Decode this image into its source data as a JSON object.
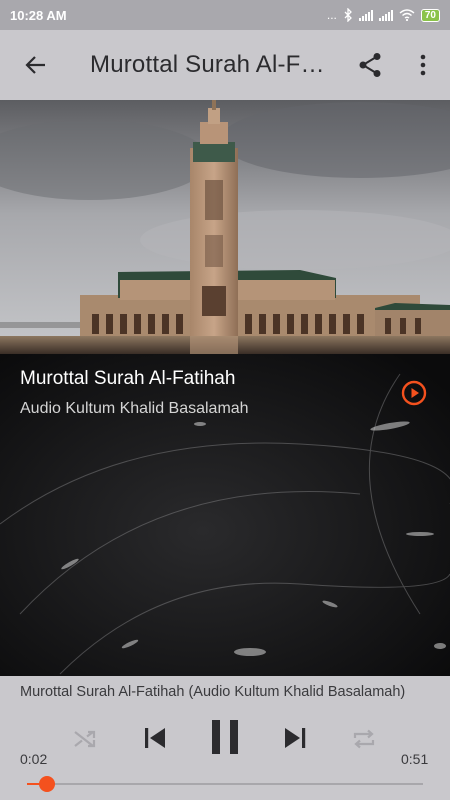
{
  "status_bar": {
    "time": "10:28 AM",
    "dots": "...",
    "battery": "70",
    "icons": [
      "bluetooth-icon",
      "signal-icon",
      "signal-icon",
      "wifi-icon",
      "battery-icon"
    ]
  },
  "app_bar": {
    "title": "Murottal Surah Al-Fatihah",
    "icons": [
      "back-arrow-icon",
      "share-icon",
      "more-vert-icon"
    ]
  },
  "track": {
    "title": "Murottal Surah Al-Fatihah",
    "artist": "Audio Kultum Khalid Basalamah"
  },
  "player": {
    "now_playing": "Murottal Surah Al-Fatihah (Audio Kultum Khalid Basalamah)",
    "elapsed": "0:02",
    "duration": "0:51",
    "progress": 0.05,
    "controls": [
      "shuffle-icon",
      "skip-previous-icon",
      "pause-icon",
      "skip-next-icon",
      "repeat-icon"
    ]
  },
  "colors": {
    "accent": "#f4511e",
    "toolbar": "#c9c8cc",
    "status_bar": "#a9a8ad",
    "artwork_bg": "#0f0f10"
  }
}
